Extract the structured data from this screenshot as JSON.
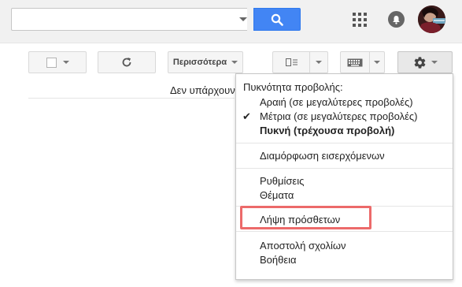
{
  "search": {
    "value": "",
    "placeholder": ""
  },
  "header": {
    "apps_icon": "apps-grid-icon",
    "notifications_icon": "notifications-icon",
    "avatar_icon": "profile-avatar"
  },
  "toolbar": {
    "more_label": "Περισσότερα"
  },
  "main": {
    "empty_text": "Δεν υπάρχουν"
  },
  "menu": {
    "header": "Πυκνότητα προβολής:",
    "density_items": [
      {
        "label": "Αραιή (σε μεγαλύτερες προβολές)",
        "checked": false,
        "bold": false
      },
      {
        "label": "Μέτρια (σε μεγαλύτερες προβολές)",
        "checked": true,
        "bold": false
      },
      {
        "label": "Πυκνή (τρέχουσα προβολή)",
        "checked": false,
        "bold": true
      }
    ],
    "check_mark": "✔",
    "configure_inbox": "Διαμόρφωση εισερχόμενων",
    "settings": "Ρυθμίσεις",
    "themes": "Θέματα",
    "get_addons": "Λήψη πρόσθετων",
    "send_feedback": "Αποστολή σχολίων",
    "help": "Βοήθεια"
  },
  "colors": {
    "search_button": "#4285f4",
    "highlight": "#ec6a6a"
  }
}
